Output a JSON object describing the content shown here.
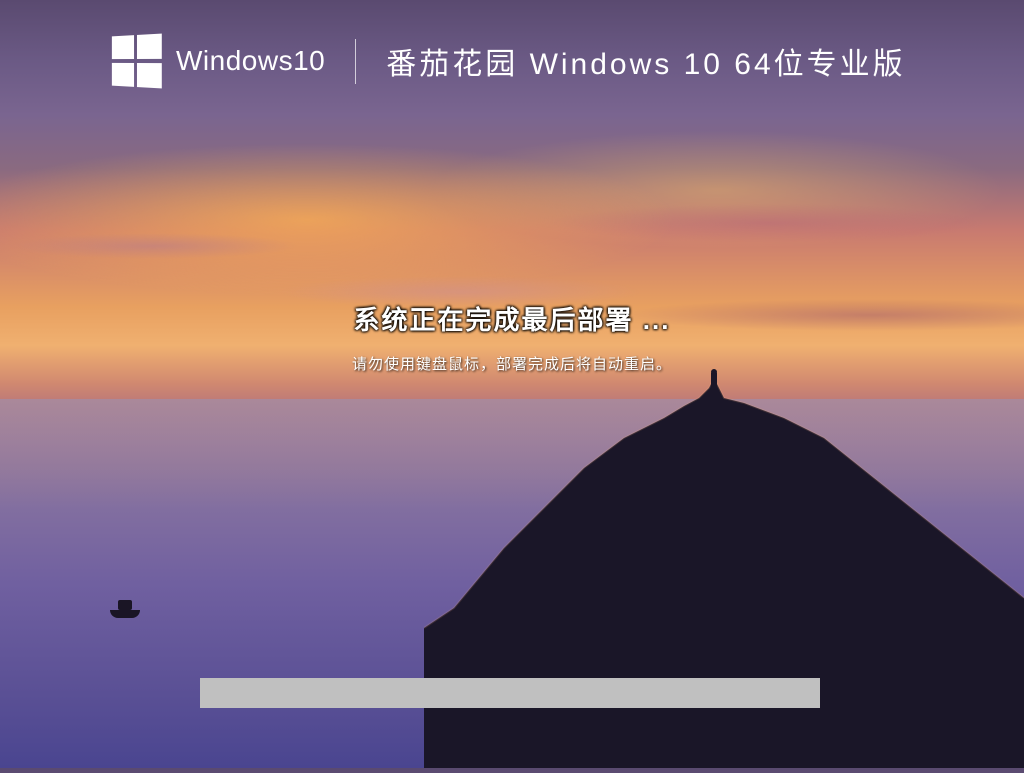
{
  "header": {
    "os_name": "Windows10",
    "product_title": "番茄花园 Windows 10 64位专业版"
  },
  "status": {
    "main": "系统正在完成最后部署 ...",
    "sub": "请勿使用键盘鼠标，部署完成后将自动重启。"
  },
  "progress": {
    "percent": 0
  },
  "colors": {
    "text": "#ffffff",
    "progress_bg": "#c0c0c0"
  }
}
